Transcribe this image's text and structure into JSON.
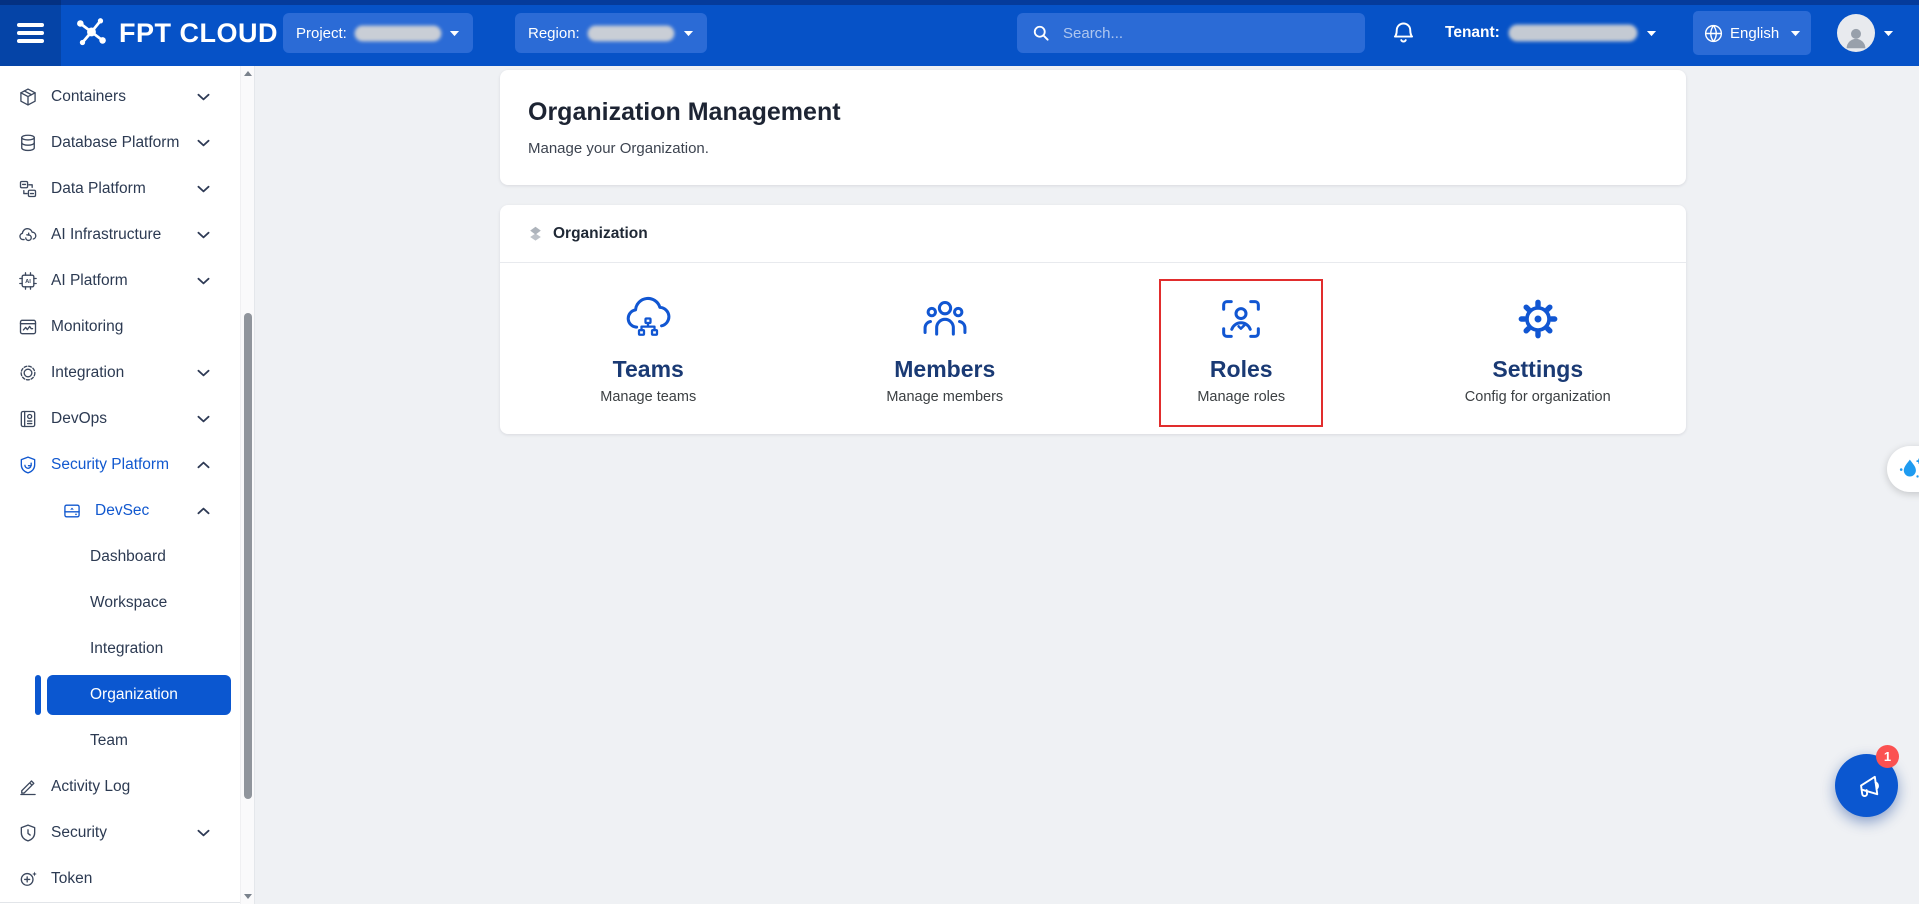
{
  "topbar": {
    "brand": "FPT CLOUD",
    "project_label": "Project:",
    "region_label": "Region:",
    "search_placeholder": "Search...",
    "tenant_label": "Tenant:",
    "language_label": "English"
  },
  "sidebar": {
    "items": [
      {
        "label": "Containers",
        "icon": "containers-icon",
        "level": 0,
        "chevron": "down"
      },
      {
        "label": "Database Platform",
        "icon": "database-platform-icon",
        "level": 0,
        "chevron": "down"
      },
      {
        "label": "Data Platform",
        "icon": "data-platform-icon",
        "level": 0,
        "chevron": "down"
      },
      {
        "label": "AI Infrastructure",
        "icon": "ai-infrastructure-icon",
        "level": 0,
        "chevron": "down"
      },
      {
        "label": "AI Platform",
        "icon": "ai-platform-icon",
        "level": 0,
        "chevron": "down"
      },
      {
        "label": "Monitoring",
        "icon": "monitoring-icon",
        "level": 0,
        "chevron": ""
      },
      {
        "label": "Integration",
        "icon": "integration-icon",
        "level": 0,
        "chevron": "down"
      },
      {
        "label": "DevOps",
        "icon": "devops-icon",
        "level": 0,
        "chevron": "down"
      },
      {
        "label": "Security Platform",
        "icon": "security-platform-icon",
        "level": 0,
        "chevron": "up",
        "blue": true
      },
      {
        "label": "DevSec",
        "icon": "devsec-icon",
        "level": 1,
        "chevron": "up",
        "blue": true
      },
      {
        "label": "Dashboard",
        "level": 2
      },
      {
        "label": "Workspace",
        "level": 2
      },
      {
        "label": "Integration",
        "level": 2
      },
      {
        "label": "Organization",
        "level": 2,
        "active": true
      },
      {
        "label": "Team",
        "level": 2
      },
      {
        "label": "Activity Log",
        "icon": "activity-log-icon",
        "level": 0,
        "chevron": ""
      },
      {
        "label": "Security",
        "icon": "security-icon",
        "level": 0,
        "chevron": "down"
      },
      {
        "label": "Token",
        "icon": "token-icon",
        "level": 0,
        "chevron": ""
      }
    ]
  },
  "page_header": {
    "title": "Organization Management",
    "subtitle": "Manage your Organization."
  },
  "organization_section": {
    "title": "Organization",
    "icon": "layers-icon",
    "tiles": [
      {
        "name": "Teams",
        "desc": "Manage teams",
        "icon": "teams-icon",
        "highlighted": false
      },
      {
        "name": "Members",
        "desc": "Manage members",
        "icon": "members-icon",
        "highlighted": false
      },
      {
        "name": "Roles",
        "desc": "Manage roles",
        "icon": "roles-icon",
        "highlighted": true
      },
      {
        "name": "Settings",
        "desc": "Config for organization",
        "icon": "settings-icon",
        "highlighted": false
      }
    ]
  },
  "floating": {
    "announcement_count": "1"
  },
  "colors": {
    "topbar": "#0652C7",
    "topbar_pill": "#2B6BD6",
    "primary": "#0B57D0",
    "link_blue": "#1158CF",
    "tile_icon": "#1156D2",
    "highlight_red": "#E12D2D",
    "badge_red": "#FB5151",
    "droplet_blue": "#1E9BF0"
  }
}
